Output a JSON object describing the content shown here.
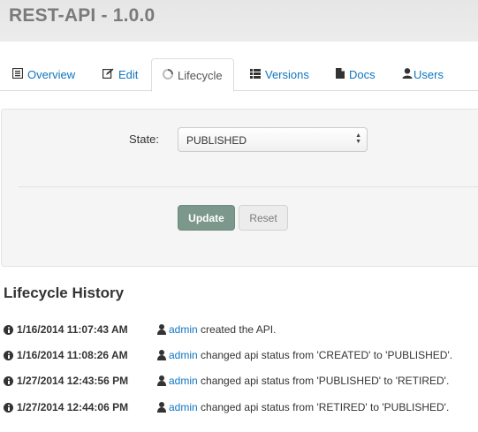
{
  "app": {
    "title": "REST-API - 1.0.0"
  },
  "tabs": [
    {
      "label": "Overview",
      "icon": "list-icon",
      "active": false
    },
    {
      "label": "Edit",
      "icon": "edit-icon",
      "active": false
    },
    {
      "label": "Lifecycle",
      "icon": "spinner-icon",
      "active": true
    },
    {
      "label": "Versions",
      "icon": "versions-list-icon",
      "active": false
    },
    {
      "label": "Docs",
      "icon": "document-icon",
      "active": false
    },
    {
      "label": "Users",
      "icon": "user-icon",
      "active": false
    }
  ],
  "form": {
    "state_label": "State:",
    "state_value": "PUBLISHED",
    "update_label": "Update",
    "reset_label": "Reset"
  },
  "history": {
    "title": "Lifecycle History",
    "entries": [
      {
        "time": "1/16/2014 11:07:43 AM",
        "user": "admin",
        "text": "created the API."
      },
      {
        "time": "1/16/2014 11:08:26 AM",
        "user": "admin",
        "text": "changed api status from 'CREATED' to 'PUBLISHED'."
      },
      {
        "time": "1/27/2014 12:43:56 PM",
        "user": "admin",
        "text": "changed api status from 'PUBLISHED' to 'RETIRED'."
      },
      {
        "time": "1/27/2014 12:44:06 PM",
        "user": "admin",
        "text": "changed api status from 'RETIRED' to 'PUBLISHED'."
      }
    ]
  },
  "colors": {
    "link": "#0f75c0",
    "update_button": "#7c978b",
    "header_bg": "#e9e9e9"
  }
}
